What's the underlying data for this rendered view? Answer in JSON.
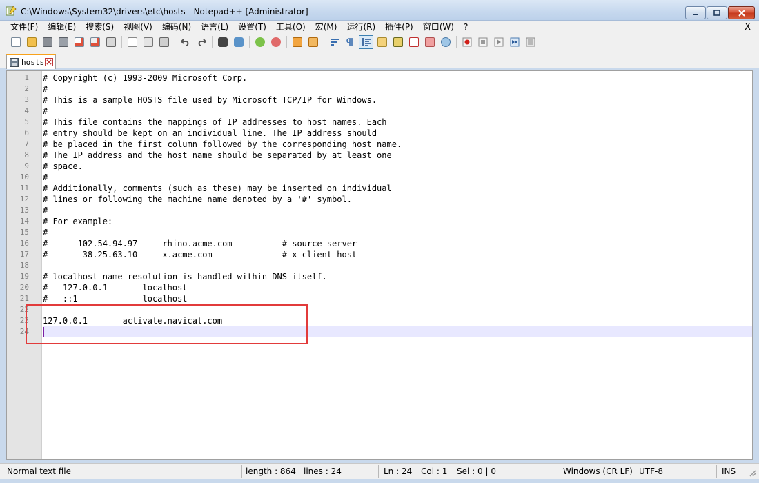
{
  "window": {
    "title": "C:\\Windows\\System32\\drivers\\etc\\hosts - Notepad++ [Administrator]"
  },
  "menu": {
    "items": [
      "文件(F)",
      "编辑(E)",
      "搜索(S)",
      "视图(V)",
      "编码(N)",
      "语言(L)",
      "设置(T)",
      "工具(O)",
      "宏(M)",
      "运行(R)",
      "插件(P)",
      "窗口(W)",
      "?"
    ],
    "close_label": "X"
  },
  "toolbar": {
    "icons": [
      "new-file-icon",
      "open-file-icon",
      "save-icon",
      "save-all-icon",
      "close-icon",
      "close-all-icon",
      "print-icon",
      "cut-icon",
      "copy-icon",
      "paste-icon",
      "undo-icon",
      "redo-icon",
      "find-icon",
      "replace-icon",
      "zoom-in-icon",
      "zoom-out-icon",
      "sync-vertical-icon",
      "sync-horizontal-icon",
      "word-wrap-icon",
      "show-all-chars-icon",
      "indent-guide-icon",
      "user-language-icon",
      "document-map-icon",
      "function-list-icon",
      "folder-workspace-icon",
      "monitoring-icon",
      "record-macro-icon",
      "stop-record-icon",
      "play-macro-icon",
      "run-macro-multiple-icon",
      "save-macro-icon"
    ],
    "active_icon": "indent-guide-icon"
  },
  "tab": {
    "label": "hosts"
  },
  "editor": {
    "lines": [
      "# Copyright (c) 1993-2009 Microsoft Corp.",
      "#",
      "# This is a sample HOSTS file used by Microsoft TCP/IP for Windows.",
      "#",
      "# This file contains the mappings of IP addresses to host names. Each",
      "# entry should be kept on an individual line. The IP address should",
      "# be placed in the first column followed by the corresponding host name.",
      "# The IP address and the host name should be separated by at least one",
      "# space.",
      "#",
      "# Additionally, comments (such as these) may be inserted on individual",
      "# lines or following the machine name denoted by a '#' symbol.",
      "#",
      "# For example:",
      "#",
      "#      102.54.94.97     rhino.acme.com          # source server",
      "#       38.25.63.10     x.acme.com              # x client host",
      "",
      "# localhost name resolution is handled within DNS itself.",
      "#   127.0.0.1       localhost",
      "#   ::1             localhost",
      "",
      "127.0.0.1       activate.navicat.com",
      ""
    ],
    "current_line": 24
  },
  "status": {
    "file_type": "Normal text file",
    "length": "length : 864",
    "lines": "lines : 24",
    "ln": "Ln : 24",
    "col": "Col : 1",
    "sel": "Sel : 0 | 0",
    "eol": "Windows (CR LF)",
    "encoding": "UTF-8",
    "mode": "INS"
  }
}
